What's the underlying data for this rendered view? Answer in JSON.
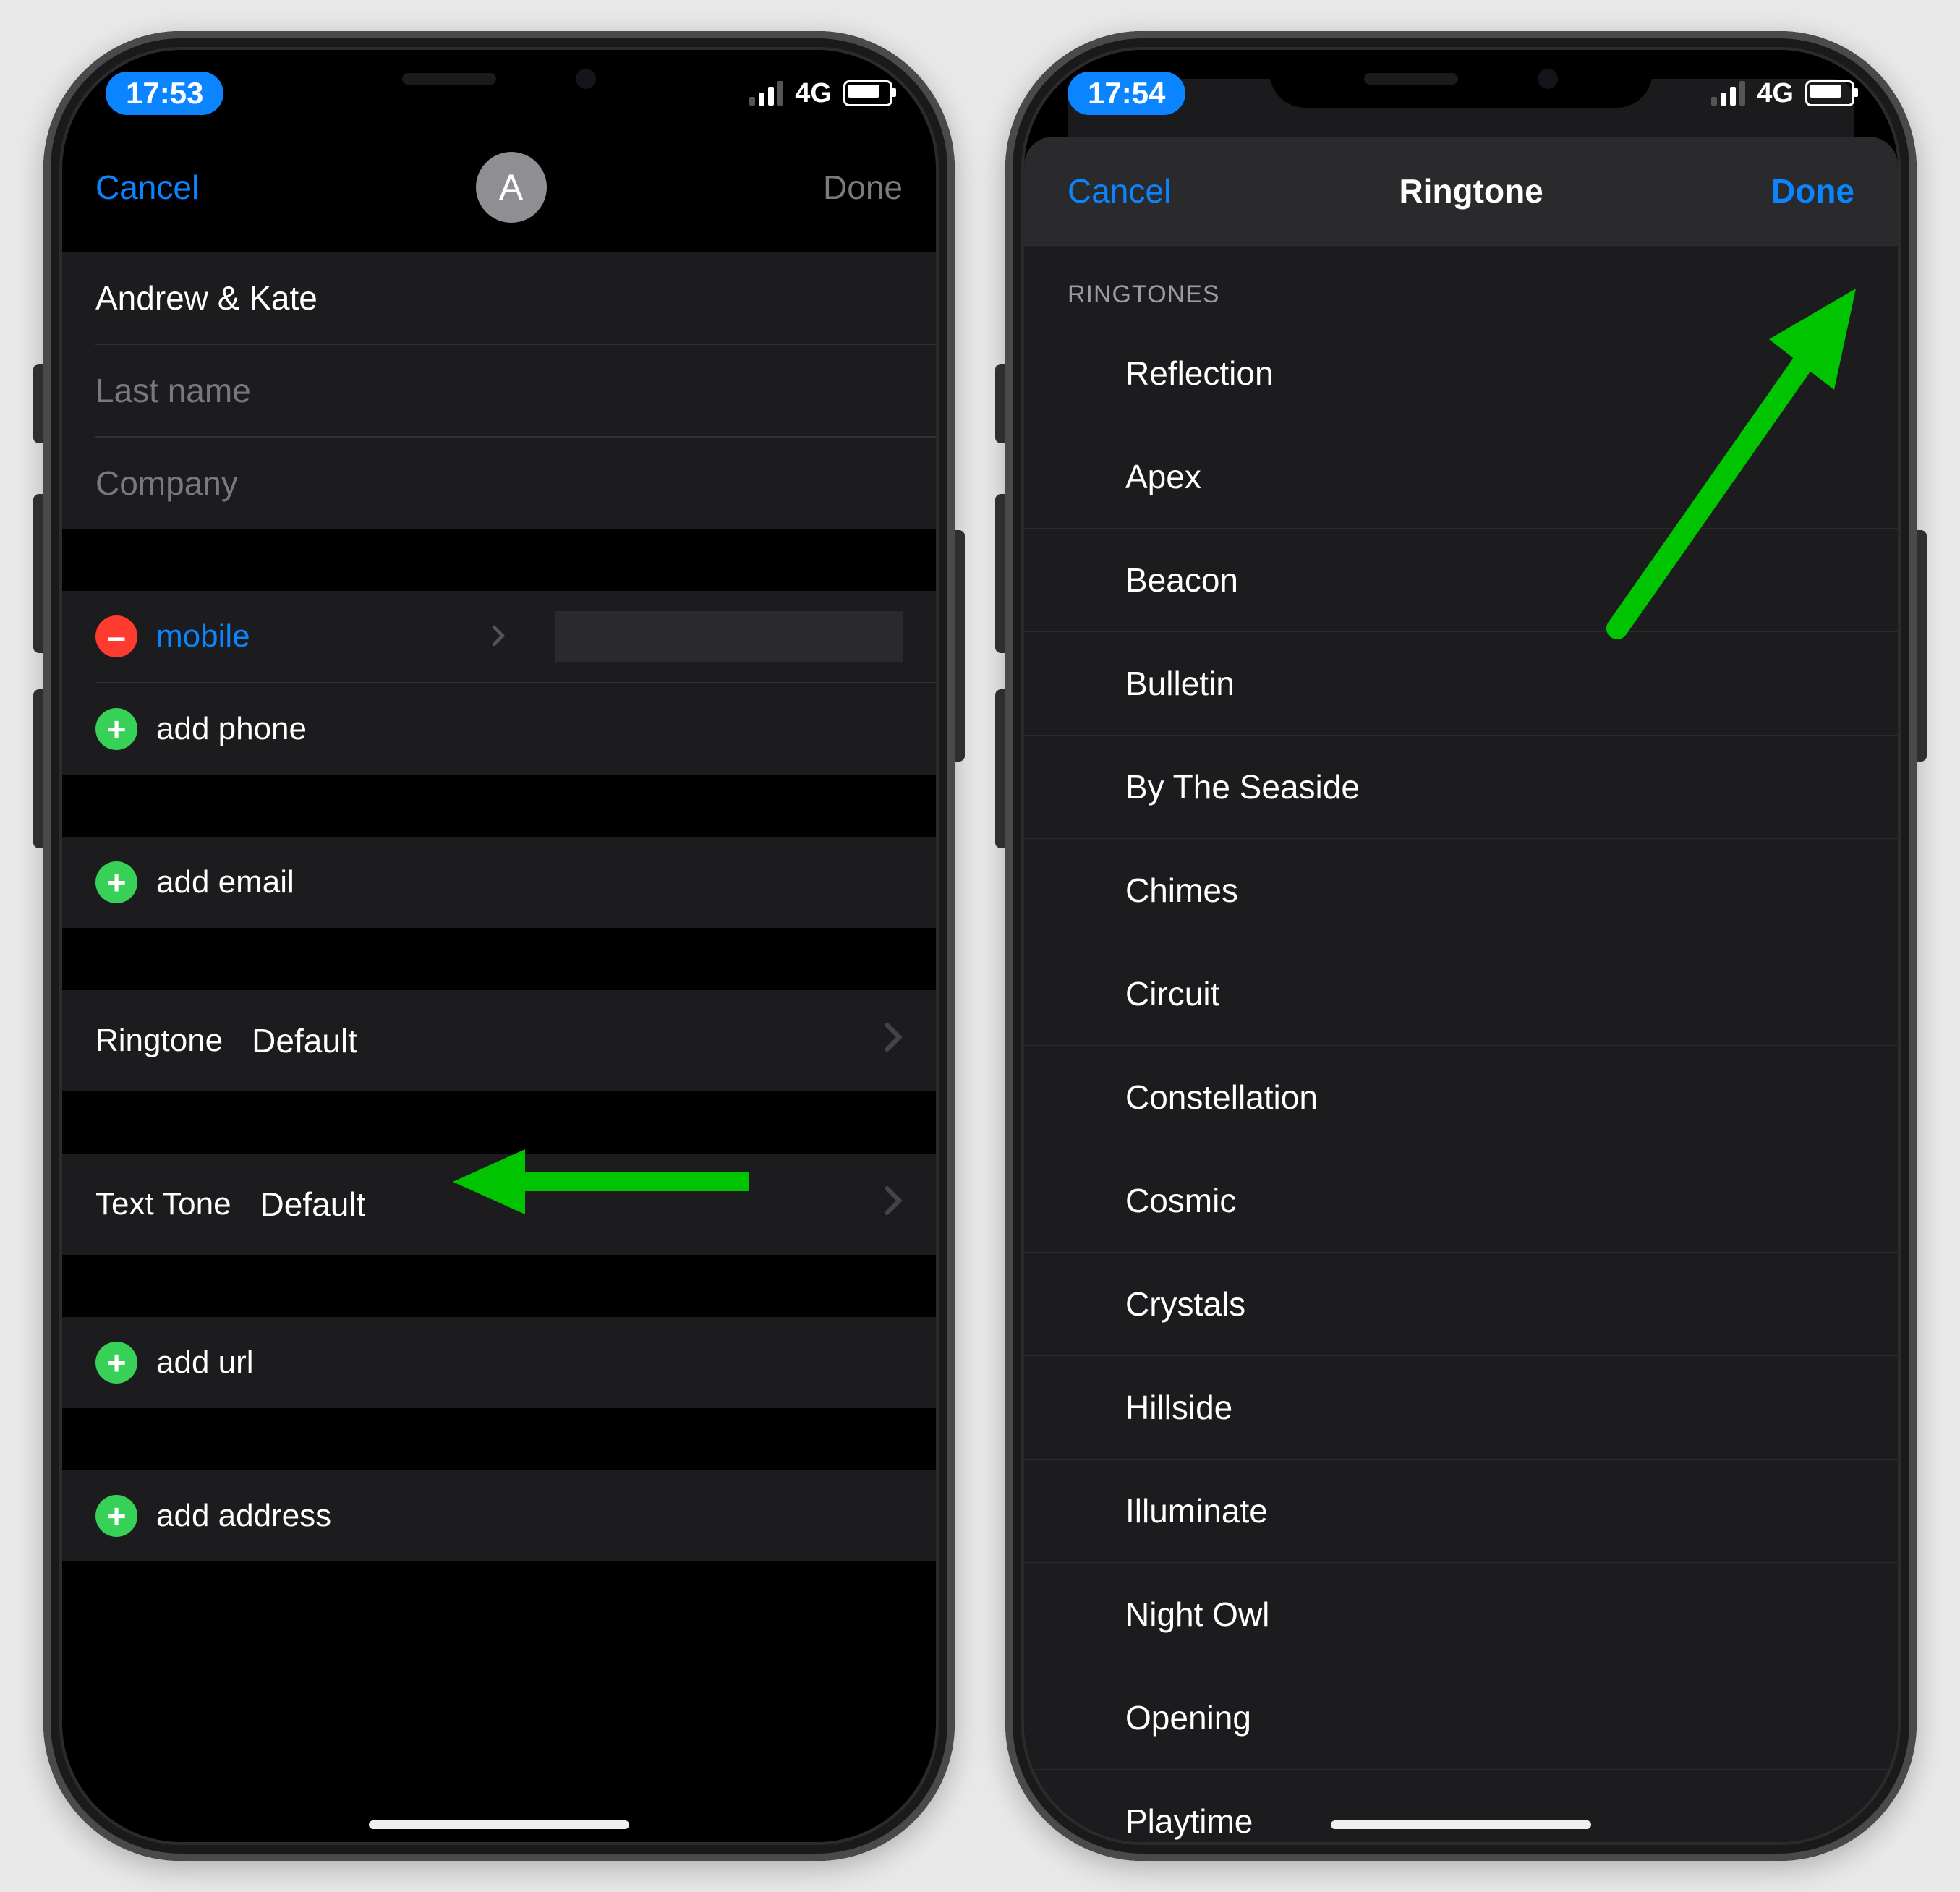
{
  "phone1": {
    "status": {
      "time": "17:53",
      "network": "4G"
    },
    "nav": {
      "cancel": "Cancel",
      "done": "Done",
      "avatar_initial": "A"
    },
    "fields": {
      "first_name": "Andrew & Kate",
      "last_name_placeholder": "Last name",
      "company_placeholder": "Company"
    },
    "phone_section": {
      "mobile_label": "mobile",
      "add_phone": "add phone"
    },
    "email_section": {
      "add_email": "add email"
    },
    "ringtone": {
      "label": "Ringtone",
      "value": "Default"
    },
    "text_tone": {
      "label": "Text Tone",
      "value": "Default"
    },
    "url": {
      "add_url": "add url"
    },
    "address": {
      "add_address": "add address"
    }
  },
  "phone2": {
    "status": {
      "time": "17:54",
      "network": "4G"
    },
    "nav": {
      "cancel": "Cancel",
      "title": "Ringtone",
      "done": "Done"
    },
    "section_header": "RINGTONES",
    "options": [
      "Reflection",
      "Apex",
      "Beacon",
      "Bulletin",
      "By The Seaside",
      "Chimes",
      "Circuit",
      "Constellation",
      "Cosmic",
      "Crystals",
      "Hillside",
      "Illuminate",
      "Night Owl",
      "Opening",
      "Playtime"
    ]
  }
}
